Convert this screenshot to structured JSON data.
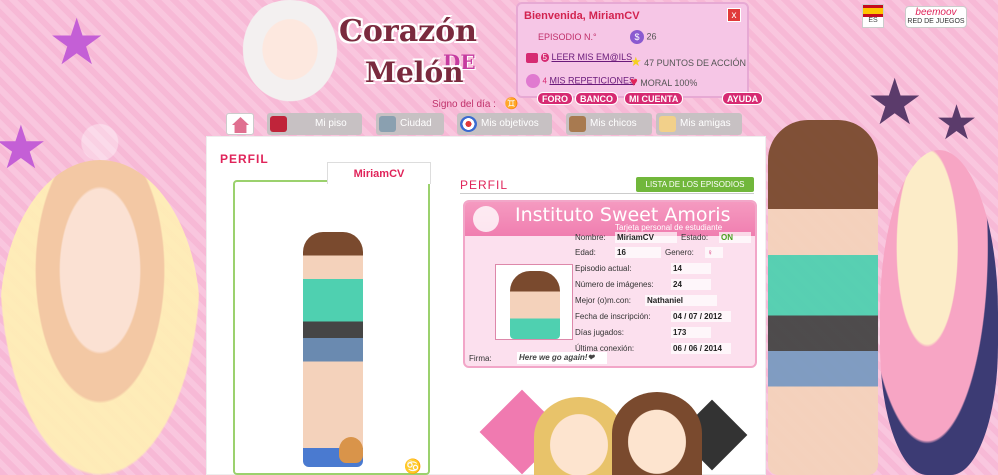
{
  "header": {
    "logo_line1": "Corazón",
    "logo_de": "DE",
    "logo_line2": "Melón",
    "sign_label": "Signo del día :",
    "sign_symbol": "♊"
  },
  "user_panel": {
    "welcome": "Bienvenida, MiriamCV",
    "close_glyph": "x",
    "episode": "EPISODIO N.°",
    "money": "26",
    "read_mails": "LEER MIS EM@ILS",
    "mail_count": "5",
    "action_points": "47 PUNTOS DE ACCIÓN",
    "repetitions": "MIS REPETICIONES",
    "repetitions_count": "4",
    "morale": "MORAL 100%",
    "buttons": [
      "FORO",
      "BANCO",
      "MI CUENTA",
      "AYUDA"
    ]
  },
  "top_right": {
    "lang": "ES",
    "network_brand": "beemoov",
    "network_label": "RED DE JUEGOS"
  },
  "nav": {
    "items": [
      "",
      "Mi piso",
      "Ciudad",
      "Mis objetivos",
      "Mis chicos",
      "Mis amigas"
    ]
  },
  "profile": {
    "title": "PERFIL",
    "avatar_tab": "MiriamCV",
    "section_title": "PERFIL",
    "episodes_button": "LISTA DE LOS EPISODIOS",
    "zodiac": "♋"
  },
  "card": {
    "school": "Instituto Sweet Amoris",
    "subtitle": "Tarjeta personal de estudiante",
    "name_label": "Nombre:",
    "name_value": "MiriamCV",
    "state_label": "Estado:",
    "state_value": "ON",
    "age_label": "Edad:",
    "age_value": "16",
    "gender_label": "Genero:",
    "gender_value": "♀",
    "episode_label": "Episodio actual:",
    "episode_value": "14",
    "images_label": "Número de imágenes:",
    "images_value": "24",
    "friend_label": "Mejor (o)m.con:",
    "friend_value": "Nathaniel",
    "signup_label": "Fecha de inscripción:",
    "signup_value": "04 / 07 / 2012",
    "days_label": "Días jugados:",
    "days_value": "173",
    "last_label": "Última conexión:",
    "last_value": "06 / 06 / 2014",
    "signature_label": "Firma:",
    "signature_value": "Here we go again!❤"
  },
  "colors": {
    "accent": "#e0245a",
    "panel_bg": "#f6c6e6",
    "button_pink": "#d62a72",
    "episodes_green": "#71b73b",
    "avatar_border": "#9bd16d"
  }
}
